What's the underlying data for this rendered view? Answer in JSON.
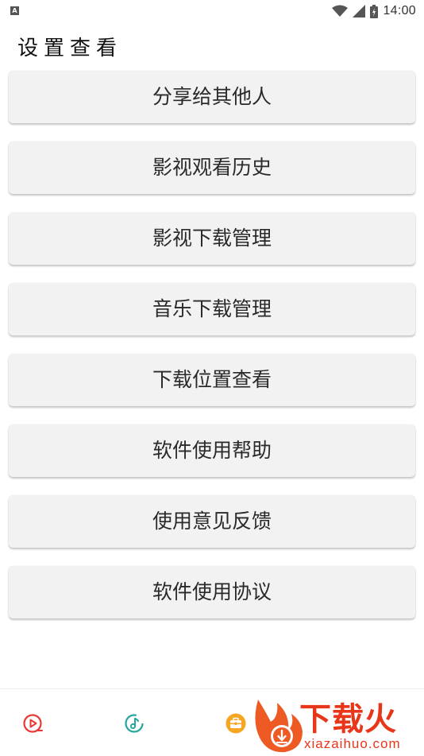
{
  "status_bar": {
    "notification_icon": "A",
    "time": "14:00",
    "icons": [
      "wifi-icon",
      "signal-icon",
      "battery-icon"
    ]
  },
  "header": {
    "title": "设置查看"
  },
  "menu": {
    "items": [
      {
        "label": "分享给其他人"
      },
      {
        "label": "影视观看历史"
      },
      {
        "label": "影视下载管理"
      },
      {
        "label": "音乐下载管理"
      },
      {
        "label": "下载位置查看"
      },
      {
        "label": "软件使用帮助"
      },
      {
        "label": "使用意见反馈"
      },
      {
        "label": "软件使用协议"
      }
    ]
  },
  "bottom_nav": {
    "items": [
      {
        "icon": "video-play-icon",
        "color": "#e53935"
      },
      {
        "icon": "music-disc-icon",
        "color": "#26a69a"
      },
      {
        "icon": "toolbox-icon",
        "color": "#f5a623"
      }
    ]
  },
  "watermark": {
    "brand": "下载火",
    "url": "xiazaihuo.com",
    "color": "#e8361b"
  }
}
